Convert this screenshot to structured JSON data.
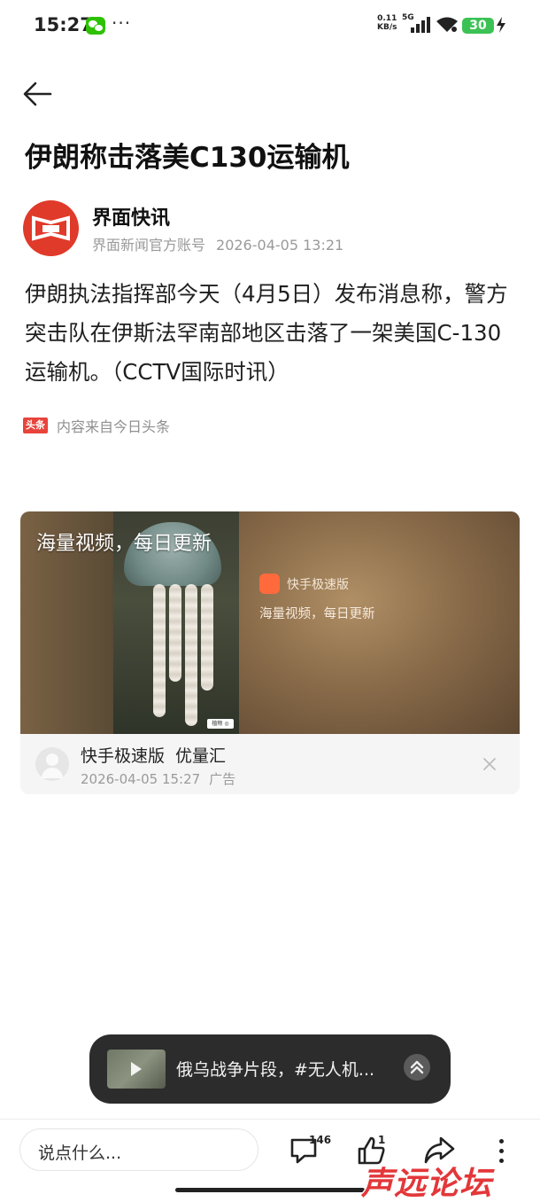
{
  "status_bar": {
    "time": "15:27",
    "net_speed_value": "0.11",
    "net_speed_unit": "KB/s",
    "network_type": "5G",
    "battery_level": "30"
  },
  "article": {
    "title": "伊朗称击落美C130运输机",
    "author": {
      "name": "界面快讯",
      "account": "界面新闻官方账号",
      "datetime": "2026-04-05 13:21"
    },
    "body": "伊朗执法指挥部今天（4月5日）发布消息称，警方突击队在伊斯法罕南部地区击落了一架美国C-130运输机。（CCTV国际时讯）",
    "source_badge": "头条",
    "source_text": "内容来自今日头条"
  },
  "ad": {
    "media_headline": "海量视频，每日更新",
    "media_app_name": "快手极速版",
    "media_app_sub": "海量视频，每日更新",
    "media_tag": "植物 ◎",
    "title": "快手极速版",
    "title_suffix": "优量汇",
    "datetime": "2026-04-05 15:27",
    "label": "广告"
  },
  "floating_video": {
    "text": "俄乌战争片段，#无人机..."
  },
  "bottom_bar": {
    "comment_placeholder": "说点什么...",
    "comment_count": "146",
    "like_count": "1"
  },
  "watermark": "声远论坛",
  "colors": {
    "accent_red": "#e03a2a",
    "battery_green": "#3cc254",
    "toutiao_red": "#e8433a"
  },
  "icons": [
    "back-arrow-icon",
    "comment-icon",
    "thumbs-up-icon",
    "share-icon",
    "more-icon",
    "close-icon",
    "expand-up-icon"
  ]
}
